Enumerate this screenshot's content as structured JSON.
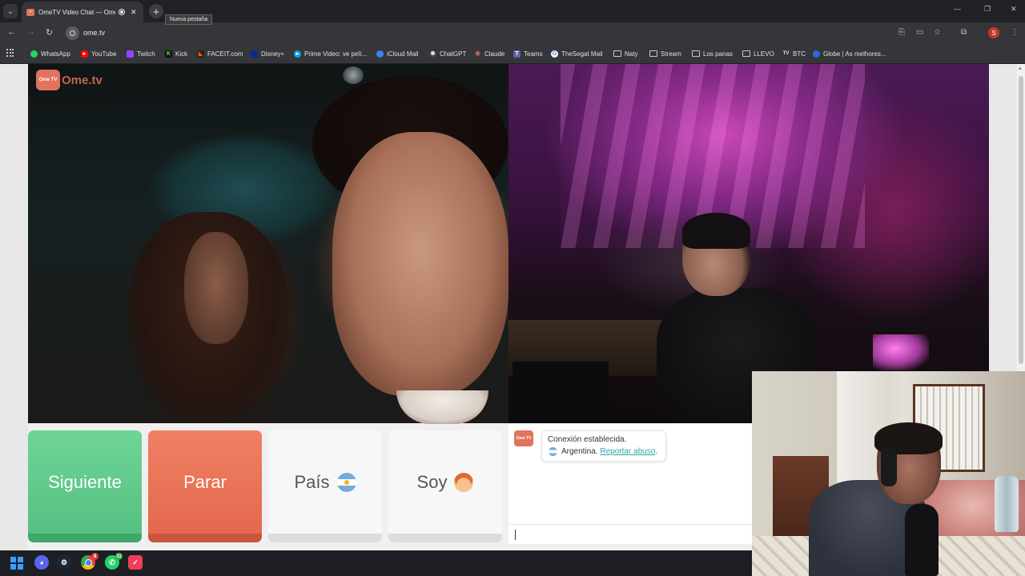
{
  "browser": {
    "tab_title": "OmeTV Video Chat — OmeTV",
    "new_tab_tooltip": "Nueva pestaña",
    "url": "ome.tv",
    "profile_initial": "S",
    "bookmarks": [
      {
        "label": "WhatsApp",
        "icon": "whatsapp-icon",
        "color": "#25d366"
      },
      {
        "label": "YouTube",
        "icon": "youtube-icon",
        "color": "#ff0000"
      },
      {
        "label": "Twitch",
        "icon": "twitch-icon",
        "color": "#9146ff"
      },
      {
        "label": "Kick",
        "icon": "kick-icon",
        "color": "#53fc18"
      },
      {
        "label": "FACEIT.com",
        "icon": "faceit-icon",
        "color": "#ff5500"
      },
      {
        "label": "Disney+",
        "icon": "disney-icon",
        "color": "#113ccf"
      },
      {
        "label": "Prime Video: ve pelí...",
        "icon": "prime-video-icon",
        "color": "#00a8e1"
      },
      {
        "label": "iCloud Mail",
        "icon": "icloud-icon",
        "color": "#3b82f6"
      },
      {
        "label": "ChatGPT",
        "icon": "chatgpt-icon",
        "color": "#74aa9c"
      },
      {
        "label": "Claude",
        "icon": "claude-icon",
        "color": "#d97757"
      },
      {
        "label": "Teams",
        "icon": "teams-icon",
        "color": "#6264a7"
      },
      {
        "label": "TheSegat Mail",
        "icon": "google-icon",
        "color": "#4285f4"
      },
      {
        "label": "Naty",
        "icon": "folder-icon",
        "color": "#c8c8c8"
      },
      {
        "label": "Stream",
        "icon": "folder-icon",
        "color": "#c8c8c8"
      },
      {
        "label": "Los panas",
        "icon": "folder-icon",
        "color": "#c8c8c8"
      },
      {
        "label": "LLEVO",
        "icon": "folder-icon",
        "color": "#c8c8c8"
      },
      {
        "label": "BTC",
        "icon": "btc-icon",
        "color": "#e8e8e8"
      },
      {
        "label": "Globe | As melhores...",
        "icon": "globe-icon",
        "color": "#2d6bd8"
      }
    ]
  },
  "ometv": {
    "logo_text": "Ome.tv",
    "logo_badge": "Ome TV",
    "buttons": {
      "next": "Siguiente",
      "stop": "Parar",
      "country": "País",
      "gender": "Soy"
    },
    "chat": {
      "status": "Conexión establecida.",
      "country": "Argentina.",
      "report_link": "Reportar abuso",
      "report_suffix": "."
    },
    "colors": {
      "next": "#55c182",
      "stop": "#e4694e",
      "brand": "#e2735d",
      "link": "#33a0a8"
    }
  },
  "taskbar": {
    "apps": [
      {
        "name": "discord-icon",
        "color": "#5865f2"
      },
      {
        "name": "steam-icon",
        "color": "#1b2838"
      },
      {
        "name": "chrome-icon",
        "color": "#4285f4",
        "badge": "9"
      },
      {
        "name": "whatsapp-icon",
        "color": "#25d366",
        "badge": "11"
      },
      {
        "name": "pocket-icon",
        "color": "#ef3f56"
      }
    ]
  }
}
